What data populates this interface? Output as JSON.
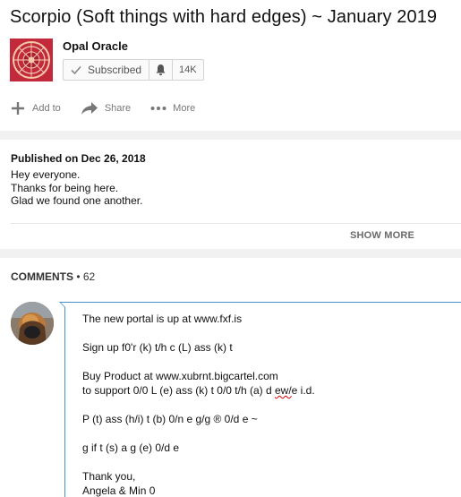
{
  "video": {
    "title": "Scorpio (Soft things with hard edges) ~ January 2019"
  },
  "channel": {
    "name": "Opal Oracle",
    "avatar_icon": "zodiac-wheel-icon",
    "subscribe_label": "Subscribed",
    "subscriber_count": "14K"
  },
  "actions": [
    {
      "icon": "plus-icon",
      "label": "Add to"
    },
    {
      "icon": "share-arrow-icon",
      "label": "Share"
    },
    {
      "icon": "more-dots-icon",
      "label": "More"
    }
  ],
  "description": {
    "published": "Published on Dec 26, 2018",
    "lines": [
      "Hey everyone.",
      "Thanks for being here.",
      "Glad we found one another."
    ],
    "show_more": "SHOW MORE"
  },
  "comments": {
    "label": "COMMENTS",
    "separator": " • ",
    "count": "62",
    "draft": {
      "line1": "The new portal is up at www.fxf.is",
      "line2": "Sign up f0'r (k) t/h c (L) ass (k) t",
      "line3": "Buy Product at www.xubrnt.bigcartel.com",
      "line4a": "to support 0/0 L (e) ass (k) t 0/0 t/h (a) d ",
      "line4b": "ew/",
      "line4c": "e i.d.",
      "line5": "P (t) ass (h/i) t (b) 0/n e g/g ® 0/d e ~",
      "line6": "g if t (s) a g (e) 0/d e",
      "line7": "Thank you,",
      "line8": "Angela & Min 0"
    }
  },
  "colors": {
    "channel_avatar_bg": "#c2293a",
    "comment_focus_border": "#4a90c8",
    "divider_band": "#f1f1f1"
  }
}
